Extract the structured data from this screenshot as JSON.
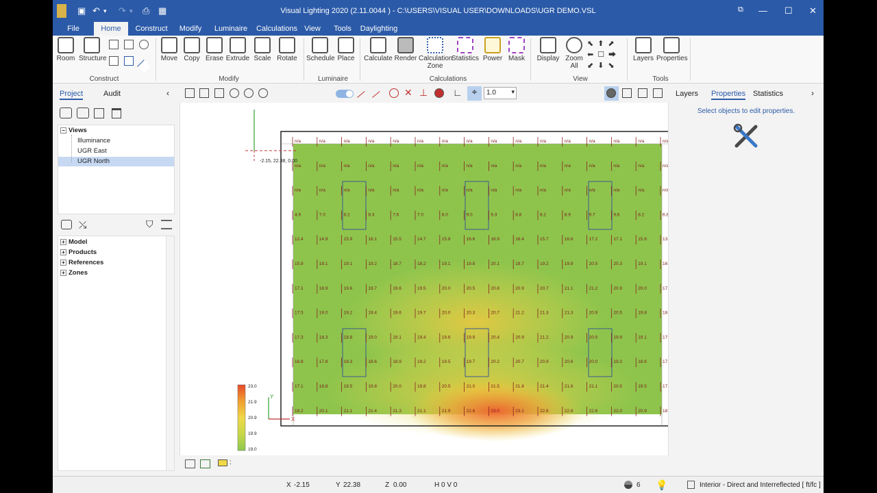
{
  "window": {
    "title": "Visual Lighting 2020 (2.11.0044 ) - C:\\USERS\\VISUAL USER\\DOWNLOADS\\UGR DEMO.VSL",
    "controls": [
      "minimize",
      "maximize",
      "close"
    ]
  },
  "menu": {
    "tabs": [
      "File",
      "Home",
      "Construct",
      "Modify",
      "Luminaire",
      "Calculations",
      "View",
      "Tools",
      "Daylighting"
    ],
    "active": "Home"
  },
  "ribbon": {
    "groups": [
      {
        "label": "Construct",
        "buttons": [
          "Room",
          "Structure"
        ]
      },
      {
        "label": "Modify",
        "buttons": [
          "Move",
          "Copy",
          "Erase",
          "Extrude",
          "Scale",
          "Rotate"
        ]
      },
      {
        "label": "Luminaire",
        "buttons": [
          "Schedule",
          "Place"
        ]
      },
      {
        "label": "Calculations",
        "buttons": [
          "Calculate",
          "Render",
          "Calculation Zone",
          "Statistics",
          "Power",
          "Mask"
        ]
      },
      {
        "label": "View",
        "buttons": [
          "Display",
          "Zoom All"
        ]
      },
      {
        "label": "Tools",
        "buttons": [
          "Layers",
          "Properties"
        ]
      }
    ]
  },
  "left_panel": {
    "tabs": [
      "Project",
      "Audit"
    ],
    "active_tab": "Project",
    "views_header": "Views",
    "views": [
      "Illuminance",
      "UGR East",
      "UGR North"
    ],
    "selected_view": "UGR North",
    "tree": [
      "Model",
      "Products",
      "References",
      "Zones"
    ]
  },
  "viewport_toolbar": {
    "line_width": "1.0"
  },
  "viewport": {
    "origin_label": "-2.15, 22.38, 0.00",
    "axis_x": "X",
    "axis_y": "Y",
    "legend": [
      "23.0",
      "21.9",
      "20.9",
      "19.9",
      "19.0"
    ],
    "legend_colors": [
      "#e84a2a",
      "#f0a030",
      "#f0d848",
      "#c8d848",
      "#8cc850"
    ],
    "grid": {
      "rows": [
        [
          "n/a",
          "n/a",
          "n/a",
          "n/a",
          "n/a",
          "n/a",
          "n/a",
          "n/a",
          "n/a",
          "n/a",
          "n/a",
          "n/a",
          "n/a",
          "n/a",
          "n/a",
          "n/a"
        ],
        [
          "n/a",
          "n/a",
          "n/a",
          "n/a",
          "n/a",
          "n/a",
          "n/a",
          "n/a",
          "n/a",
          "n/a",
          "n/a",
          "n/a",
          "n/a",
          "n/a",
          "n/a",
          "n/a"
        ],
        [
          "n/a",
          "n/a",
          "n/a",
          "n/a",
          "n/a",
          "n/a",
          "n/a",
          "n/a",
          "n/a",
          "n/a",
          "n/a",
          "n/a",
          "n/a",
          "n/a",
          "n/a",
          "n/a"
        ],
        [
          "4.9",
          "7.0",
          "8.2",
          "8.3",
          "7.6",
          "7.0",
          "8.0",
          "9.0",
          "9.3",
          "8.8",
          "8.2",
          "8.9",
          "9.7",
          "9.6",
          "8.2",
          "6.8"
        ],
        [
          "12.4",
          "14.9",
          "15.9",
          "16.1",
          "15.5",
          "14.7",
          "15.8",
          "16.6",
          "16.9",
          "16.4",
          "15.7",
          "16.6",
          "17.2",
          "17.1",
          "15.8",
          "13.2"
        ],
        [
          "15.8",
          "18.1",
          "19.1",
          "19.2",
          "18.7",
          "18.2",
          "19.1",
          "19.8",
          "20.1",
          "19.7",
          "19.2",
          "19.9",
          "20.5",
          "20.3",
          "19.1",
          "16.6"
        ],
        [
          "17.1",
          "18.9",
          "19.6",
          "19.7",
          "19.6",
          "19.5",
          "20.0",
          "20.5",
          "20.8",
          "20.9",
          "20.7",
          "21.1",
          "21.2",
          "20.9",
          "20.0",
          "17.9"
        ],
        [
          "17.5",
          "19.0",
          "19.2",
          "19.4",
          "19.6",
          "19.7",
          "20.0",
          "20.3",
          "20.7",
          "21.2",
          "21.3",
          "21.3",
          "20.9",
          "20.5",
          "19.8",
          "18.2"
        ],
        [
          "17.3",
          "18.3",
          "18.8",
          "19.0",
          "19.1",
          "19.4",
          "19.6",
          "19.9",
          "20.4",
          "20.9",
          "21.2",
          "20.9",
          "20.5",
          "19.9",
          "19.1",
          "17.8"
        ],
        [
          "16.8",
          "17.8",
          "18.3",
          "18.6",
          "18.9",
          "19.2",
          "19.5",
          "19.7",
          "20.2",
          "20.7",
          "20.9",
          "20.6",
          "20.0",
          "19.3",
          "18.6",
          "17.4"
        ],
        [
          "17.1",
          "18.8",
          "19.5",
          "19.8",
          "20.0",
          "19.8",
          "20.5",
          "21.0",
          "21.5",
          "21.8",
          "21.4",
          "21.6",
          "21.1",
          "20.5",
          "19.5",
          "17.7"
        ],
        [
          "18.2",
          "20.1",
          "21.1",
          "21.4",
          "21.3",
          "21.1",
          "21.9",
          "22.6",
          "23.0",
          "23.1",
          "22.6",
          "22.8",
          "22.6",
          "22.0",
          "20.9",
          "18.8"
        ]
      ]
    }
  },
  "right_panel": {
    "tabs": [
      "Layers",
      "Properties",
      "Statistics"
    ],
    "active_tab": "Properties",
    "hint": "Select objects to edit properties."
  },
  "status": {
    "x_label": "X",
    "x": "-2.15",
    "y_label": "Y",
    "y": "22.38",
    "z_label": "Z",
    "z": "0.00",
    "hv": "H 0  V 0",
    "count": "6",
    "mode": "Interior - Direct and Interreflected [ ft/fc ]"
  }
}
